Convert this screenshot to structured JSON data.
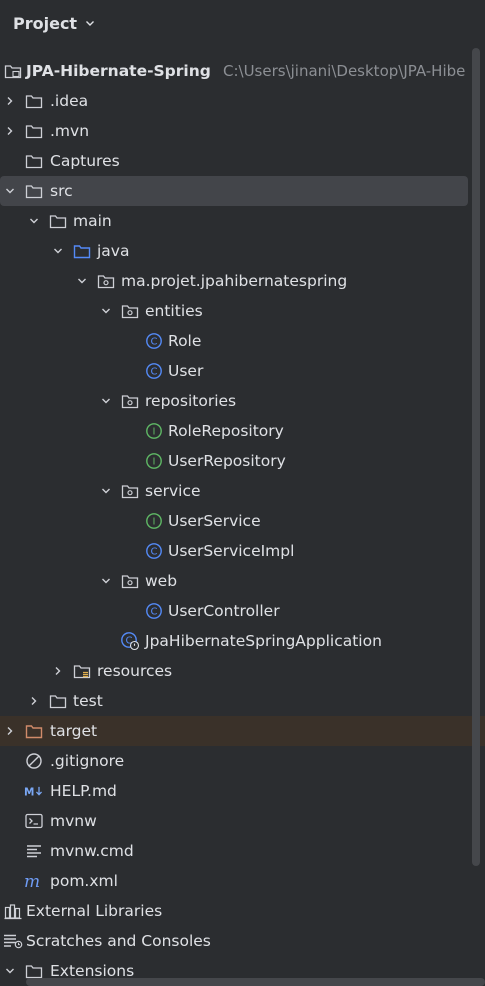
{
  "panel": {
    "title": "Project"
  },
  "tree": [
    {
      "label": "JPA-Hibernate-Spring",
      "path": "C:\\Users\\jinani\\Desktop\\JPA-Hibe",
      "icon": "module-folder-icon",
      "chevron": "none",
      "bold": true
    },
    {
      "label": ".idea",
      "icon": "folder-icon",
      "chevron": "right"
    },
    {
      "label": ".mvn",
      "icon": "folder-icon",
      "chevron": "right"
    },
    {
      "label": "Captures",
      "icon": "folder-icon",
      "chevron": "none"
    },
    {
      "label": "src",
      "icon": "folder-icon",
      "chevron": "down",
      "selected": true
    },
    {
      "label": "main",
      "icon": "folder-icon",
      "chevron": "down"
    },
    {
      "label": "java",
      "icon": "source-folder-icon",
      "chevron": "down"
    },
    {
      "label": "ma.projet.jpahibernatespring",
      "icon": "package-icon",
      "chevron": "down"
    },
    {
      "label": "entities",
      "icon": "package-icon",
      "chevron": "down"
    },
    {
      "label": "Role",
      "icon": "class-icon",
      "chevron": "none"
    },
    {
      "label": "User",
      "icon": "class-icon",
      "chevron": "none"
    },
    {
      "label": "repositories",
      "icon": "package-icon",
      "chevron": "down"
    },
    {
      "label": "RoleRepository",
      "icon": "interface-icon",
      "chevron": "none"
    },
    {
      "label": "UserRepository",
      "icon": "interface-icon",
      "chevron": "none"
    },
    {
      "label": "service",
      "icon": "package-icon",
      "chevron": "down"
    },
    {
      "label": "UserService",
      "icon": "interface-icon",
      "chevron": "none"
    },
    {
      "label": "UserServiceImpl",
      "icon": "class-icon",
      "chevron": "none"
    },
    {
      "label": "web",
      "icon": "package-icon",
      "chevron": "down"
    },
    {
      "label": "UserController",
      "icon": "class-icon",
      "chevron": "none"
    },
    {
      "label": "JpaHibernateSpringApplication",
      "icon": "spring-boot-class-icon",
      "chevron": "none"
    },
    {
      "label": "resources",
      "icon": "resources-folder-icon",
      "chevron": "right"
    },
    {
      "label": "test",
      "icon": "folder-icon",
      "chevron": "right"
    },
    {
      "label": "target",
      "icon": "excluded-folder-icon",
      "chevron": "right",
      "excluded": true
    },
    {
      "label": ".gitignore",
      "icon": "ignore-file-icon",
      "chevron": "none"
    },
    {
      "label": "HELP.md",
      "icon": "markdown-file-icon",
      "chevron": "none"
    },
    {
      "label": "mvnw",
      "icon": "shell-script-icon",
      "chevron": "none"
    },
    {
      "label": "mvnw.cmd",
      "icon": "text-file-icon",
      "chevron": "none"
    },
    {
      "label": "pom.xml",
      "icon": "maven-file-icon",
      "chevron": "none"
    },
    {
      "label": "External Libraries",
      "icon": "libraries-icon",
      "chevron": "none"
    },
    {
      "label": "Scratches and Consoles",
      "icon": "scratches-icon",
      "chevron": "none"
    },
    {
      "label": "Extensions",
      "icon": "folder-icon",
      "chevron": "down"
    }
  ],
  "colors": {
    "background": "#2b2d30",
    "selection": "#43454a",
    "excluded_background": "#3a3129",
    "excluded_folder": "#d08b6a",
    "class_icon": "#548af7",
    "interface_icon": "#5fb865"
  }
}
